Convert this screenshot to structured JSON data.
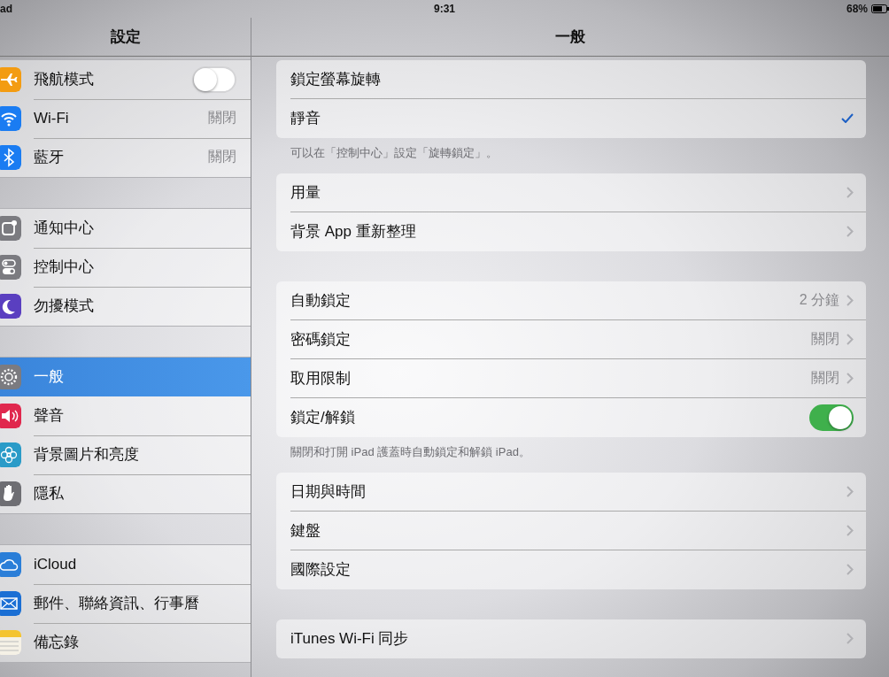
{
  "status_bar": {
    "device": "ad",
    "time": "9:31",
    "battery": "68%"
  },
  "sidebar": {
    "title": "設定",
    "groups": [
      {
        "items": [
          {
            "label": "飛航模式",
            "kind": "toggle",
            "on": false,
            "selected": false
          },
          {
            "label": "Wi-Fi",
            "kind": "value",
            "value": "關閉",
            "selected": false
          },
          {
            "label": "藍牙",
            "kind": "value",
            "value": "關閉",
            "selected": false
          }
        ]
      },
      {
        "items": [
          {
            "label": "通知中心",
            "kind": "plain",
            "selected": false
          },
          {
            "label": "控制中心",
            "kind": "plain",
            "selected": false
          },
          {
            "label": "勿擾模式",
            "kind": "plain",
            "selected": false
          }
        ]
      },
      {
        "items": [
          {
            "label": "一般",
            "kind": "plain",
            "selected": true
          },
          {
            "label": "聲音",
            "kind": "plain",
            "selected": false
          },
          {
            "label": "背景圖片和亮度",
            "kind": "plain",
            "selected": false
          },
          {
            "label": "隱私",
            "kind": "plain",
            "selected": false
          }
        ]
      },
      {
        "items": [
          {
            "label": "iCloud",
            "kind": "plain",
            "selected": false
          },
          {
            "label": "郵件、聯絡資訊、行事曆",
            "kind": "plain",
            "selected": false
          },
          {
            "label": "備忘錄",
            "kind": "plain",
            "selected": false
          }
        ]
      }
    ]
  },
  "detail": {
    "title": "一般",
    "groups": [
      {
        "rows": [
          {
            "label": "鎖定螢幕旋轉",
            "kind": "check",
            "checked": false
          },
          {
            "label": "靜音",
            "kind": "check",
            "checked": true
          }
        ],
        "footer": "可以在「控制中心」設定「旋轉鎖定」。"
      },
      {
        "rows": [
          {
            "label": "用量",
            "kind": "disclosure"
          },
          {
            "label": "背景 App 重新整理",
            "kind": "disclosure"
          }
        ]
      },
      {
        "rows": [
          {
            "label": "自動鎖定",
            "kind": "disclosure",
            "value": "2 分鐘"
          },
          {
            "label": "密碼鎖定",
            "kind": "disclosure",
            "value": "關閉"
          },
          {
            "label": "取用限制",
            "kind": "disclosure",
            "value": "關閉"
          },
          {
            "label": "鎖定/解鎖",
            "kind": "toggle",
            "on": true
          }
        ],
        "footer": "關閉和打開 iPad 護蓋時自動鎖定和解鎖 iPad。"
      },
      {
        "rows": [
          {
            "label": "日期與時間",
            "kind": "disclosure"
          },
          {
            "label": "鍵盤",
            "kind": "disclosure"
          },
          {
            "label": "國際設定",
            "kind": "disclosure"
          }
        ]
      },
      {
        "rows": [
          {
            "label": "iTunes Wi-Fi 同步",
            "kind": "disclosure"
          }
        ]
      }
    ]
  }
}
